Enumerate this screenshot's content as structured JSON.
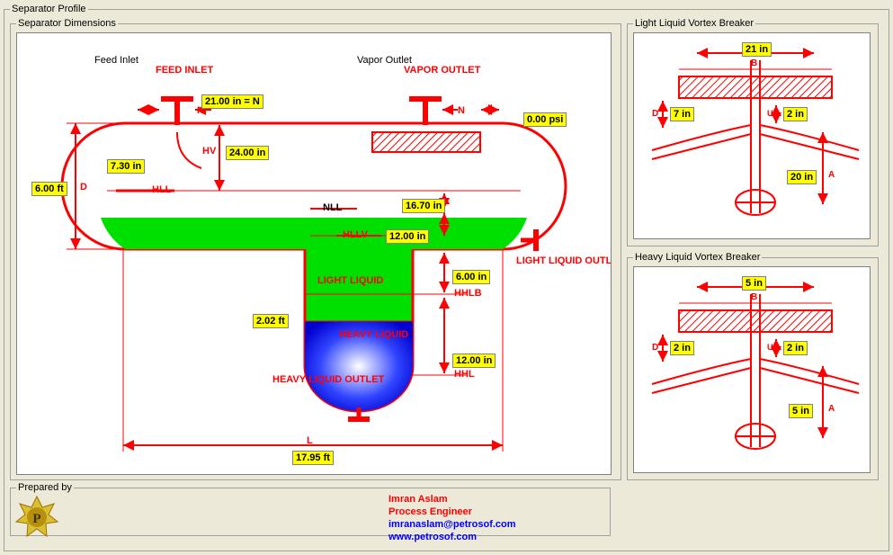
{
  "outer_title": "Separator Profile",
  "dims_title": "Separator Dimensions",
  "vb_light_title": "Light Liquid Vortex Breaker",
  "vb_heavy_title": "Heavy Liquid Vortex Breaker",
  "prepared_title": "Prepared by",
  "dims": {
    "feed_inlet_header": "Feed Inlet",
    "vapor_outlet_header": "Vapor Outlet",
    "feed_inlet_label": "FEED INLET",
    "vapor_outlet_label": "VAPOR OUTLET",
    "light_liquid_outlet_label": "LIGHT LIQUID OUTLET",
    "heavy_liquid_outlet_label": "HEAVY LIQUID OUTLET",
    "light_liquid_zone": "LIGHT LIQUID",
    "heavy_liquid_zone": "HEAVY LIQUID",
    "N_left": "N",
    "N_right": "N",
    "N_vapor": "N",
    "HV": "HV",
    "HLL": "HLL",
    "NLL": "NLL",
    "HLLV": "HLLV",
    "HHLB": "HHLB",
    "HHL": "HHL",
    "D": "D",
    "L": "L",
    "val_21_00_in_N": "21.00 in = N",
    "val_24_00_in": "24.00 in",
    "val_7_30_in": "7.30 in",
    "val_6_00_ft": "6.00 ft",
    "val_0_psi": "0.00 psi",
    "val_16_70_in": "16.70 in",
    "val_12a_in": "12.00 in",
    "val_6_in": "6.00 in",
    "val_12b_in": "12.00 in",
    "val_2_02_ft": "2.02 ft",
    "val_17_95_ft": "17.95 ft"
  },
  "vb_light": {
    "top": "21 in",
    "left": "7 in",
    "right": "2 in",
    "bottom": "20 in"
  },
  "vb_heavy": {
    "top": "5 in",
    "left": "2 in",
    "right": "2 in",
    "bottom": "5 in"
  },
  "prepared": {
    "name": "Imran Aslam",
    "role": "Process Engineer",
    "email": "imranaslam@petrosof.com",
    "site": "www.petrosof.com"
  }
}
